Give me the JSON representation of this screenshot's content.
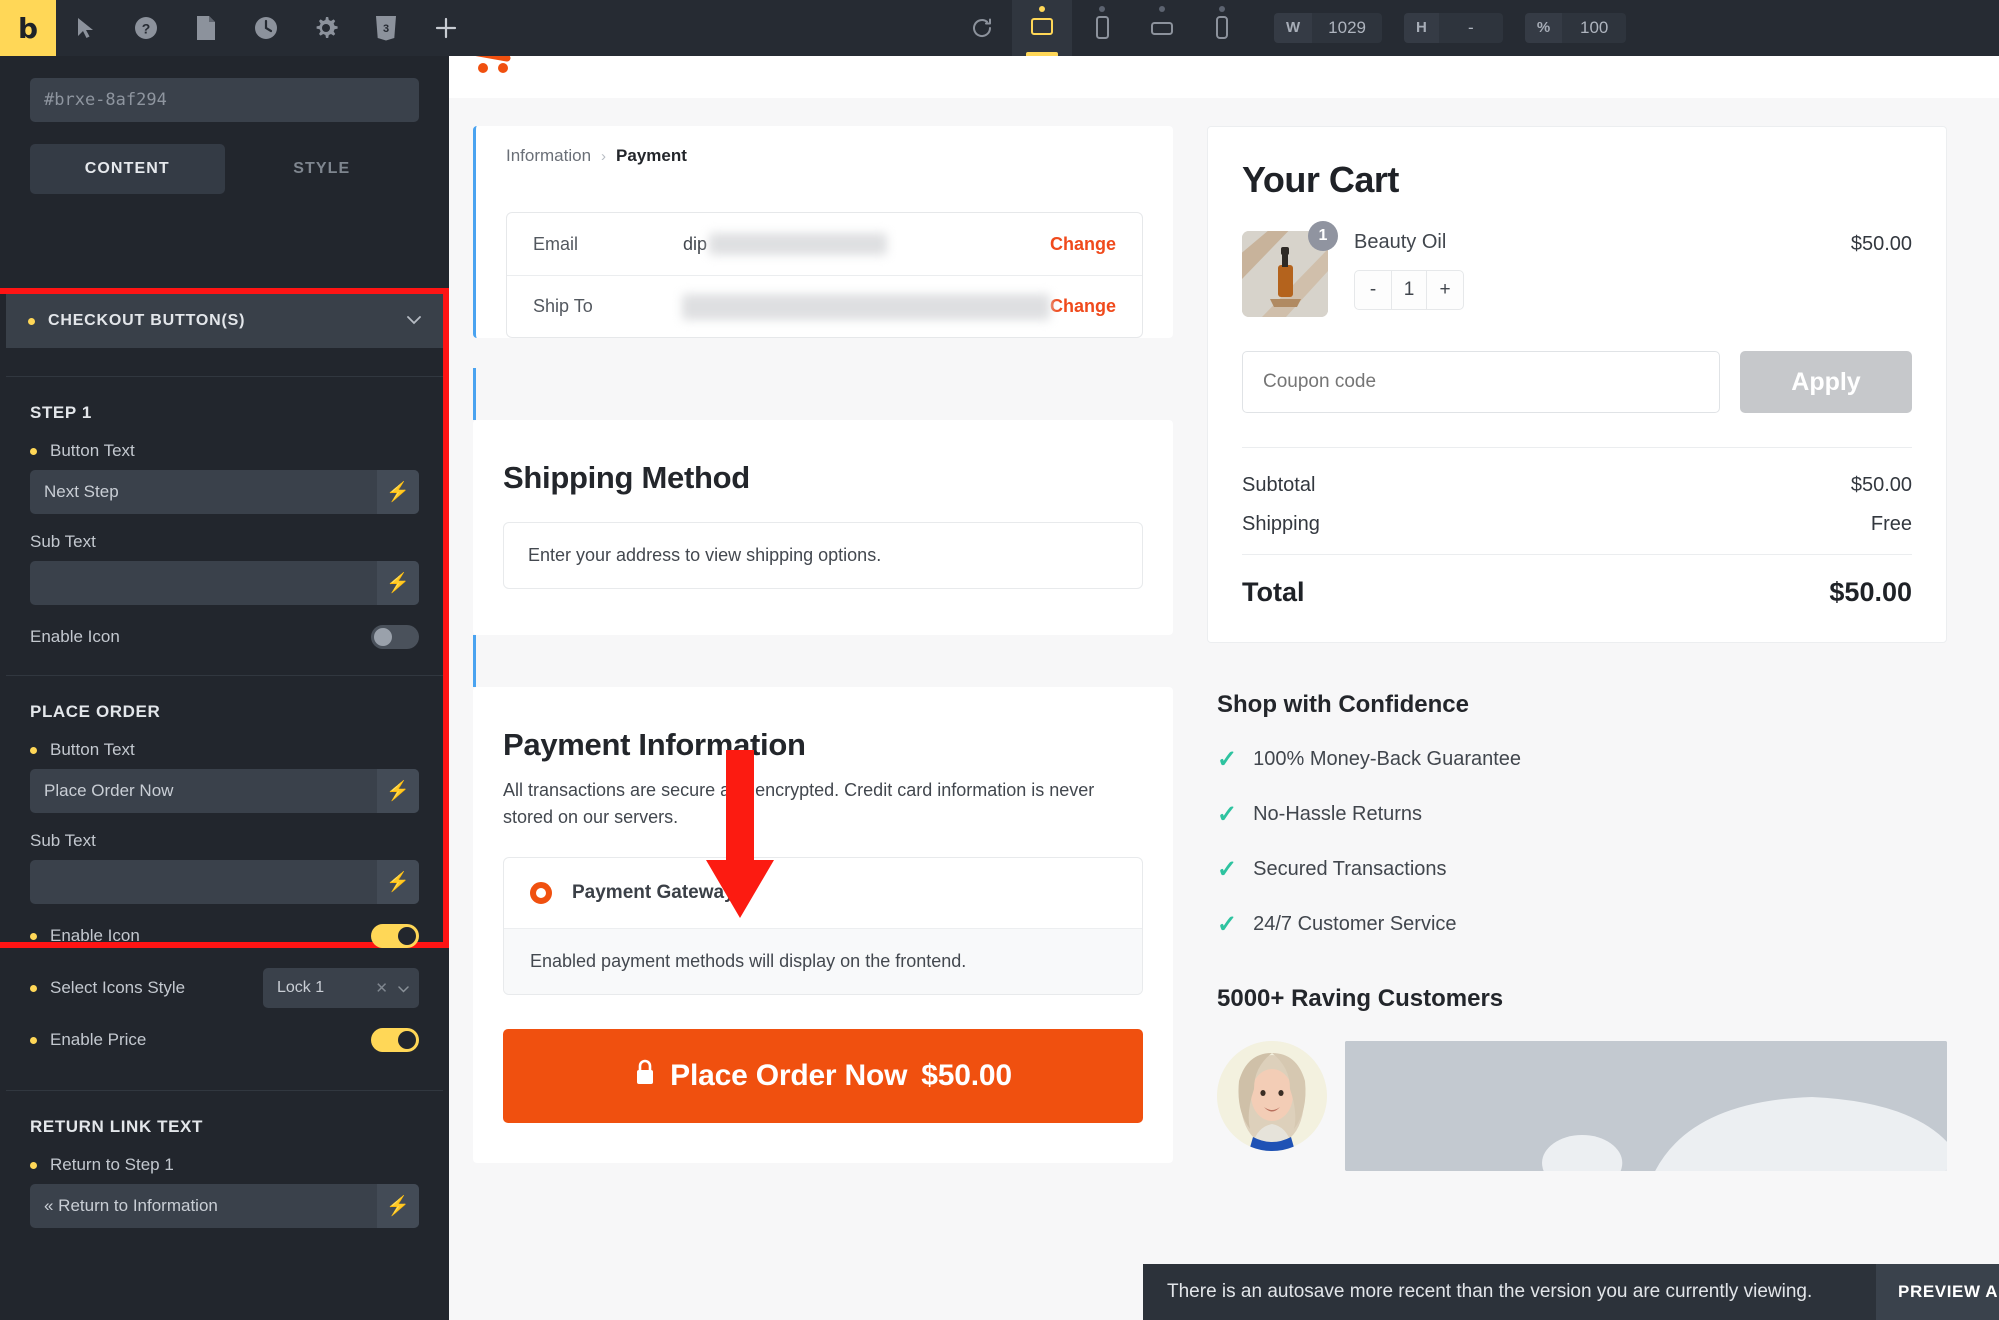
{
  "toolbar": {
    "logo_label": "b",
    "icons": [
      "cursor-icon",
      "help-icon",
      "pages-icon",
      "history-icon",
      "settings-icon",
      "css-icon",
      "add-icon"
    ],
    "refresh_icon": "refresh-icon",
    "devices": [
      {
        "name": "desktop",
        "active": true
      },
      {
        "name": "tablet-portrait",
        "active": false
      },
      {
        "name": "tablet-landscape",
        "active": false
      },
      {
        "name": "mobile",
        "active": false
      }
    ],
    "width": {
      "label": "W",
      "value": "1029"
    },
    "height": {
      "label": "H",
      "value": "-"
    },
    "zoom": {
      "label": "%",
      "value": "100"
    }
  },
  "sidebar": {
    "element_id": "#brxe-8af294",
    "tabs": [
      {
        "label": "CONTENT",
        "active": true
      },
      {
        "label": "STYLE",
        "active": false
      }
    ],
    "section": {
      "title": "CHECKOUT BUTTON(S)",
      "chevron": "chevron-down-icon"
    },
    "step1": {
      "group_title": "STEP 1",
      "button_text_label": "Button Text",
      "button_text_value": "Next Step",
      "sub_text_label": "Sub Text",
      "sub_text_value": "",
      "enable_icon_label": "Enable Icon",
      "enable_icon_on": false
    },
    "place_order": {
      "group_title": "PLACE ORDER",
      "button_text_label": "Button Text",
      "button_text_value": "Place Order Now",
      "sub_text_label": "Sub Text",
      "sub_text_value": "",
      "enable_icon_label": "Enable Icon",
      "enable_icon_on": true,
      "select_icons_label": "Select Icons Style",
      "select_icons_value": "Lock 1",
      "enable_price_label": "Enable Price",
      "enable_price_on": true
    },
    "return_link": {
      "group_title": "RETURN LINK TEXT",
      "field_label": "Return to Step 1",
      "field_value": "« Return to Information"
    }
  },
  "checkout": {
    "breadcrumb": {
      "prev": "Information",
      "separator": "›",
      "current": "Payment"
    },
    "summary_rows": [
      {
        "key": "Email",
        "value": "dip",
        "action": "Change"
      },
      {
        "key": "Ship To",
        "value": "",
        "action": "Change"
      }
    ],
    "shipping": {
      "heading": "Shipping Method",
      "note": "Enter your address to view shipping options."
    },
    "payment": {
      "heading": "Payment Information",
      "description": "All transactions are secure and encrypted. Credit card information is never stored on our servers.",
      "gateway_label": "Payment Gateway",
      "gateway_selected": true,
      "footer_note": "Enabled payment methods will display on the frontend."
    },
    "order_button": {
      "icon": "lock-icon",
      "label": "Place Order Now",
      "price": "$50.00"
    }
  },
  "cart": {
    "title": "Your Cart",
    "item": {
      "name": "Beauty Oil",
      "price": "$50.00",
      "qty": "1",
      "badge": "1",
      "minus": "-",
      "plus": "+"
    },
    "coupon_placeholder": "Coupon code",
    "apply_label": "Apply",
    "totals": [
      {
        "label": "Subtotal",
        "value": "$50.00"
      },
      {
        "label": "Shipping",
        "value": "Free"
      }
    ],
    "total": {
      "label": "Total",
      "value": "$50.00"
    }
  },
  "trust": {
    "heading": "Shop with Confidence",
    "items": [
      "100% Money-Back Guarantee",
      "No-Hassle Returns",
      "Secured Transactions",
      "24/7 Customer Service"
    ],
    "raving_heading": "5000+ Raving Customers"
  },
  "autosave": {
    "message": "There is an autosave more recent than the version you are currently viewing.",
    "button": "PREVIEW AUTOSAVE",
    "close": "✕"
  },
  "colors": {
    "brand_yellow": "#ffd757",
    "accent_orange": "#f0500f",
    "panel_dark": "#22262d",
    "highlight_red": "#ff1414",
    "section_blue": "#4aa3f0",
    "check_green": "#2ec3a0"
  }
}
